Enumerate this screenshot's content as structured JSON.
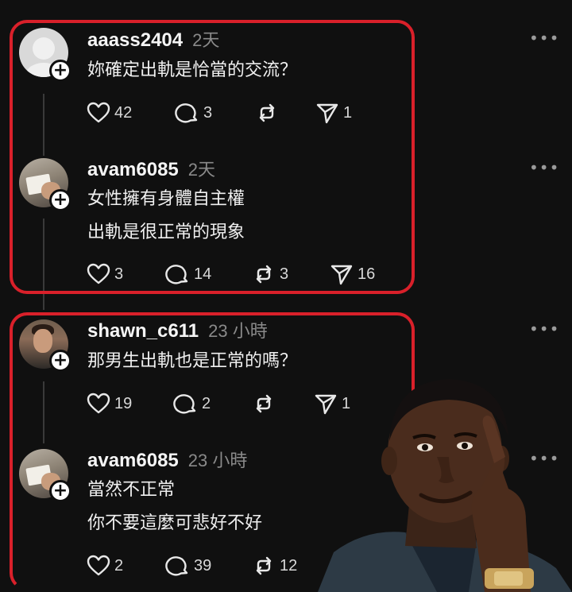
{
  "posts": [
    {
      "username": "aaass2404",
      "time": "2天",
      "text": "妳確定出軌是恰當的交流？",
      "likes": "42",
      "comments": "3",
      "reposts": "",
      "shares": "1"
    },
    {
      "username": "avam6085",
      "time": "2天",
      "text": "女性擁有身體自主權\n出軌是很正常的現象",
      "likes": "3",
      "comments": "14",
      "reposts": "3",
      "shares": "16"
    },
    {
      "username": "shawn_c611",
      "time": "23 小時",
      "text": "那男生出軌也是正常的嗎？",
      "likes": "19",
      "comments": "2",
      "reposts": "",
      "shares": "1"
    },
    {
      "username": "avam6085",
      "time": "23 小時",
      "text": "當然不正常\n你不要這麼可悲好不好",
      "likes": "2",
      "comments": "39",
      "reposts": "12",
      "shares": ""
    }
  ],
  "more_label": "•••",
  "plus_label": "+",
  "colors": {
    "background": "#101010",
    "highlight": "#d9202a"
  },
  "icons": [
    "heart-icon",
    "comment-icon",
    "repost-icon",
    "share-icon",
    "plus-icon",
    "more-icon"
  ]
}
